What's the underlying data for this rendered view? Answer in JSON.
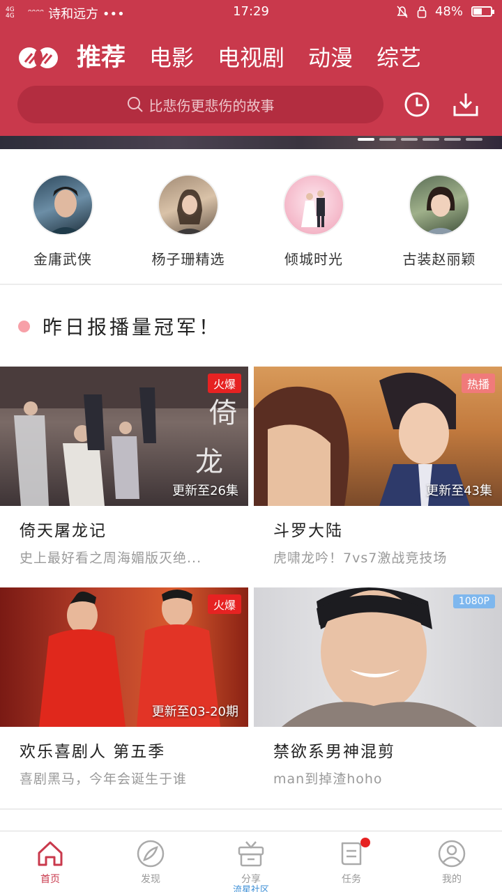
{
  "status_bar": {
    "network": "4G 4G",
    "signal": "ᵔᵔᵔᵔ",
    "carrier": "诗和远方 •••",
    "time": "17:29",
    "battery_text": "48%",
    "battery_level": 0.48
  },
  "header": {
    "tabs": [
      "推荐",
      "电影",
      "电视剧",
      "动漫",
      "综艺"
    ],
    "active_tab": 0,
    "search_placeholder": "比悲伤更悲伤的故事"
  },
  "banner": {
    "page_count": 6,
    "active_page": 0
  },
  "categories": [
    {
      "label": "金庸武侠",
      "icon": "jinyong-avatar"
    },
    {
      "label": "杨子珊精选",
      "icon": "yangzishan-avatar"
    },
    {
      "label": "倾城时光",
      "icon": "qingcheng-avatar"
    },
    {
      "label": "古装赵丽颖",
      "icon": "zhaoliying-avatar"
    }
  ],
  "section": {
    "title": "昨日报播量冠军！"
  },
  "cards": [
    {
      "title": "倚天屠龙记",
      "subtitle": "史上最好看之周海媚版灭绝...",
      "badge": "火爆",
      "badge_kind": "hot",
      "episode": "更新至26集"
    },
    {
      "title": "斗罗大陆",
      "subtitle": "虎啸龙吟！7vs7激战竞技场",
      "badge": "热播",
      "badge_kind": "warm",
      "episode": "更新至43集"
    },
    {
      "title": "欢乐喜剧人 第五季",
      "subtitle": "喜剧黑马，今年会诞生于谁",
      "badge": "火爆",
      "badge_kind": "hot",
      "episode": "更新至03-20期"
    },
    {
      "title": "禁欲系男神混剪",
      "subtitle": "man到掉渣hoho",
      "badge": "1080P",
      "badge_kind": "hd",
      "episode": ""
    }
  ],
  "bottom_nav": [
    {
      "label": "首页",
      "icon": "home-icon",
      "active": true
    },
    {
      "label": "发现",
      "icon": "compass-icon",
      "active": false
    },
    {
      "label": "分享",
      "icon": "gift-box-icon",
      "active": false,
      "extra": "流星社区"
    },
    {
      "label": "任务",
      "icon": "task-icon",
      "active": false,
      "badge": true
    },
    {
      "label": "我的",
      "icon": "profile-icon",
      "active": false
    }
  ],
  "colors": {
    "brand": "#c9394c",
    "search_bg": "#b32d40",
    "badge_hot": "#e62222",
    "badge_warm": "#f07a7a",
    "badge_hd": "#7eb7ee"
  }
}
